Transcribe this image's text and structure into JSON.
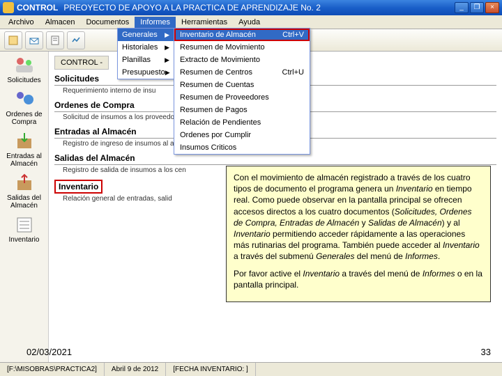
{
  "titlebar": {
    "app": "CONTROL",
    "project": "PREOYECTO DE APOYO A LA PRACTICA DE APRENDIZAJE No. 2"
  },
  "menubar": [
    "Archivo",
    "Almacen",
    "Documentos",
    "Informes",
    "Herramientas",
    "Ayuda"
  ],
  "submenu1": [
    {
      "label": "Generales",
      "arrow": true,
      "hl": true
    },
    {
      "label": "Historiales",
      "arrow": true
    },
    {
      "label": "Planillas",
      "arrow": true
    },
    {
      "label": "Presupuesto",
      "arrow": true
    }
  ],
  "submenu2": [
    {
      "label": "Inventario de Almacén",
      "shortcut": "Ctrl+V",
      "hl": true
    },
    {
      "label": "Resumen de Movimiento"
    },
    {
      "label": "Extracto de Movimiento"
    },
    {
      "label": "Resumen de Centros",
      "shortcut": "Ctrl+U"
    },
    {
      "label": "Resumen de Cuentas"
    },
    {
      "label": "Resumen de Proveedores"
    },
    {
      "label": "Resumen de Pagos"
    },
    {
      "label": "Relación de Pendientes"
    },
    {
      "label": "Ordenes por Cumplir"
    },
    {
      "label": "Insumos Criticos"
    }
  ],
  "sidebar": [
    {
      "label": "Solicitudes"
    },
    {
      "label": "Ordenes de Compra"
    },
    {
      "label": "Entradas al Almacén"
    },
    {
      "label": "Salidas del Almacén"
    },
    {
      "label": "Inventario"
    }
  ],
  "inner_title": "CONTROL -",
  "sections": [
    {
      "title": "Solicitudes",
      "desc": "Requerimiento interno de insu"
    },
    {
      "title": "Ordenes de Compra",
      "desc": "Solicitud de insumos a los proveedores"
    },
    {
      "title": "Entradas al Almacén",
      "desc": "Registro de ingreso de insumos al alma"
    },
    {
      "title": "Salidas del Almacén",
      "desc": "Registro de salida de insumos a los cen"
    },
    {
      "title": "Inventario",
      "desc": "Relación general de entradas, salid",
      "hl": true
    }
  ],
  "callout": {
    "p1a": "Con el movimiento de almacén registrado a través de los cuatro tipos de documento el programa genera un ",
    "p1b": "Inventario",
    "p1c": " en tiempo real. Como puede observar en la pantalla principal se ofrecen accesos directos a los cuatro documentos (",
    "p1d": "Solicitudes, Ordenes de Compra, Entradas de Almacén",
    "p1e": " y ",
    "p1f": "Salidas de Almacén",
    "p1g": ") y al ",
    "p1h": "Inventario",
    "p1i": " permitiendo acceder rápidamente a las operaciones más rutinarias del programa. También puede acceder al ",
    "p1j": "Inventario",
    "p1k": " a través del submenú ",
    "p1l": "Generales",
    "p1m": " del menú de ",
    "p1n": "Informes",
    "p1o": ".",
    "p2a": "Por favor active el ",
    "p2b": "Inventario",
    "p2c": " a través del menú de ",
    "p2d": "Informes",
    "p2e": " o en la pantalla principal."
  },
  "overlay_date": "02/03/2021",
  "overlay_page": "33",
  "statusbar": {
    "path": "[F:\\MISOBRAS\\PRACTICA2]",
    "date": "Abril 9 de 2012",
    "inv": "[FECHA INVENTARIO: ]"
  }
}
